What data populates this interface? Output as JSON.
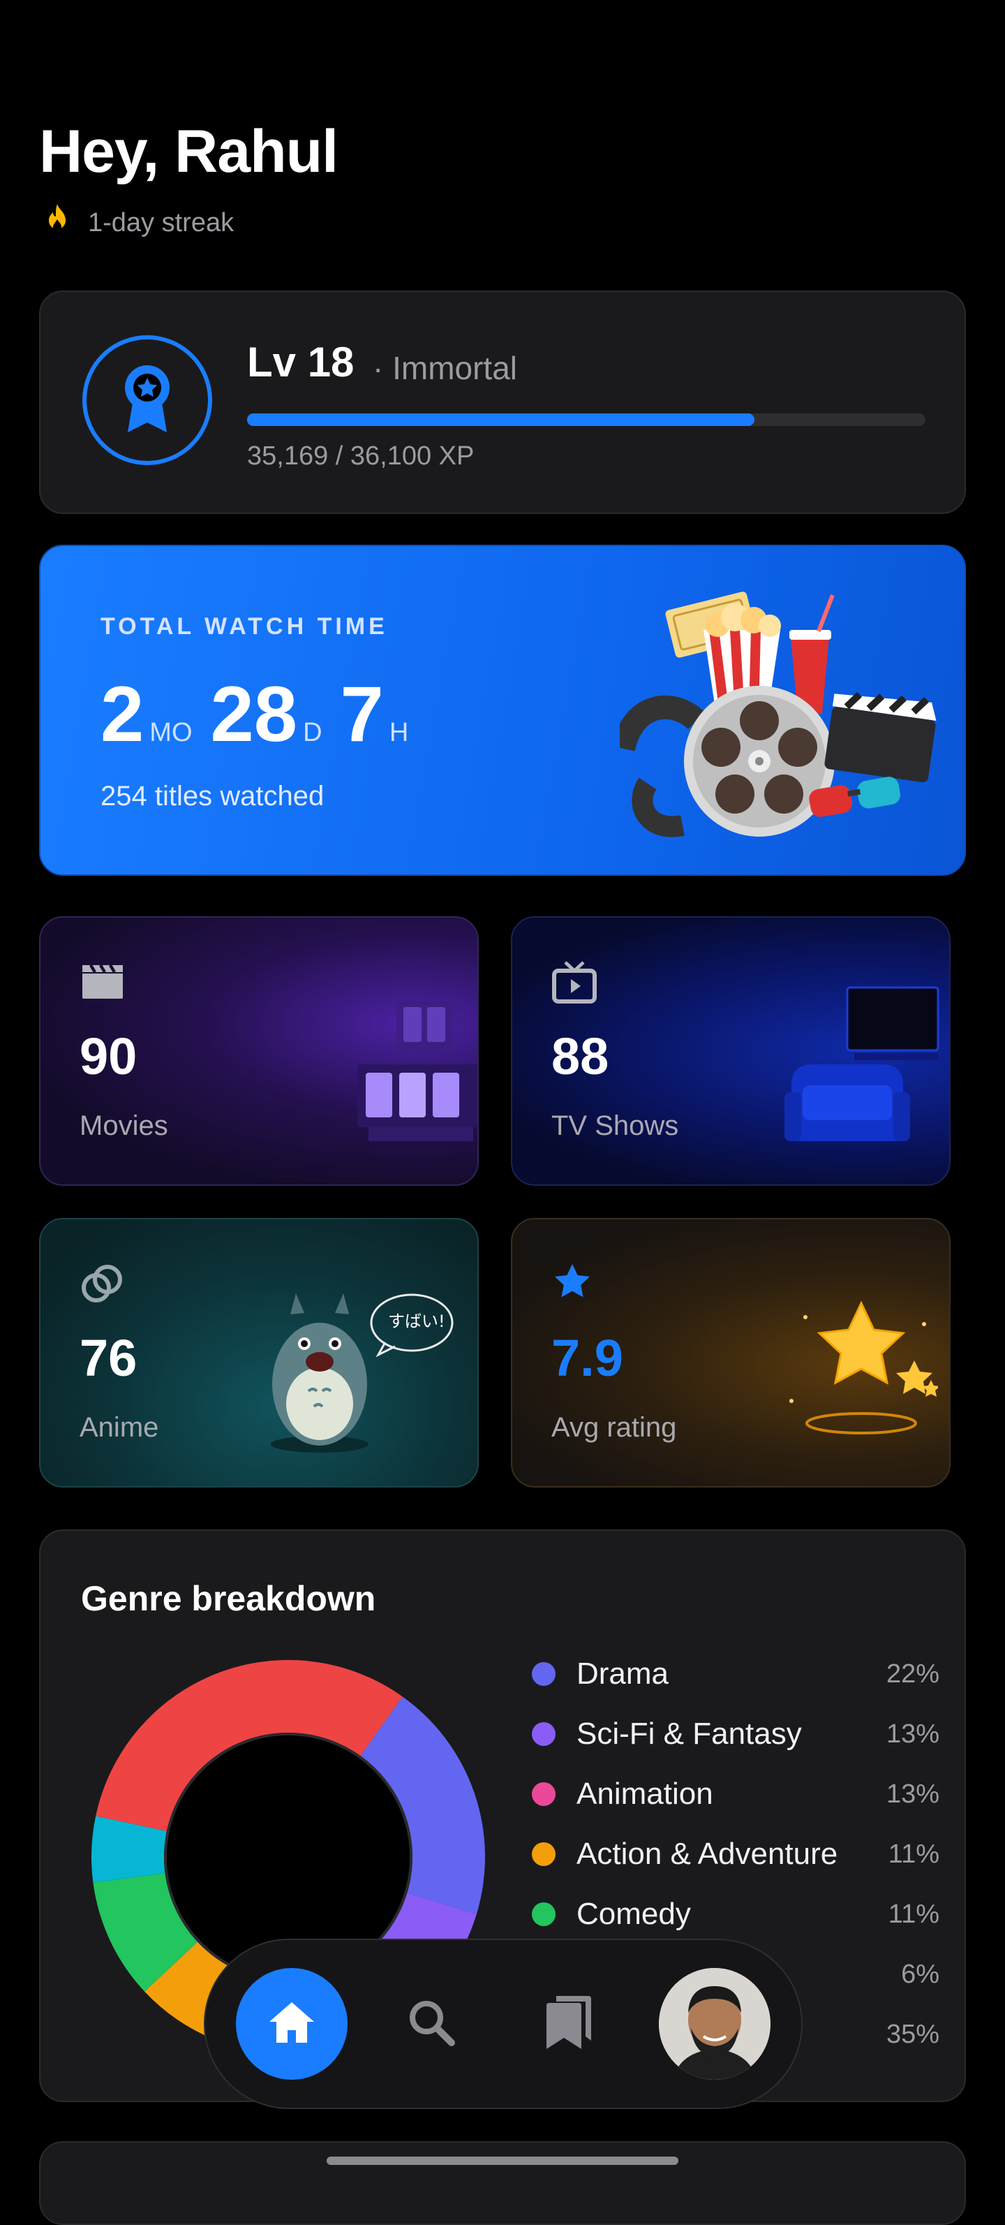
{
  "header": {
    "greeting": "Hey, Rahul",
    "streak": "1-day streak"
  },
  "level": {
    "level_label": "Lv 18",
    "tier": "· Immortal",
    "xp_text": "35,169 / 36,100 XP",
    "xp_progress": 0.7478
  },
  "watch_time": {
    "label": "TOTAL WATCH TIME",
    "months": "2",
    "months_unit": "MO",
    "days": "28",
    "days_unit": "D",
    "hours": "7",
    "hours_unit": "H",
    "titles": "254 titles watched"
  },
  "stats": {
    "movies": {
      "value": "90",
      "label": "Movies"
    },
    "tv": {
      "value": "88",
      "label": "TV Shows"
    },
    "anime": {
      "value": "76",
      "label": "Anime"
    },
    "rating": {
      "value": "7.9",
      "label": "Avg rating"
    }
  },
  "genre": {
    "title": "Genre breakdown",
    "items": [
      {
        "name": "Drama",
        "pct": "22%",
        "color": "#6366f1"
      },
      {
        "name": "Sci-Fi & Fantasy",
        "pct": "13%",
        "color": "#8b5cf6"
      },
      {
        "name": "Animation",
        "pct": "13%",
        "color": "#ec4899"
      },
      {
        "name": "Action & Adventure",
        "pct": "11%",
        "color": "#f59e0b"
      },
      {
        "name": "Comedy",
        "pct": "11%",
        "color": "#22c55e"
      },
      {
        "name": "",
        "pct": "6%",
        "color": "#06b6d4"
      },
      {
        "name": "",
        "pct": "35%",
        "color": "#ef4444"
      }
    ]
  },
  "chart_data": {
    "type": "pie",
    "categories": [
      "Drama",
      "Sci-Fi & Fantasy",
      "Animation",
      "Action & Adventure",
      "Comedy",
      "",
      ""
    ],
    "values": [
      22,
      13,
      13,
      11,
      11,
      6,
      35
    ],
    "title": "Genre breakdown"
  },
  "nav": {
    "items": [
      "home-icon",
      "search-icon",
      "bookmarks-icon",
      "avatar"
    ]
  },
  "colors": {
    "accent": "#1a7dff",
    "background": "#000000",
    "card": "#1a1a1c"
  }
}
